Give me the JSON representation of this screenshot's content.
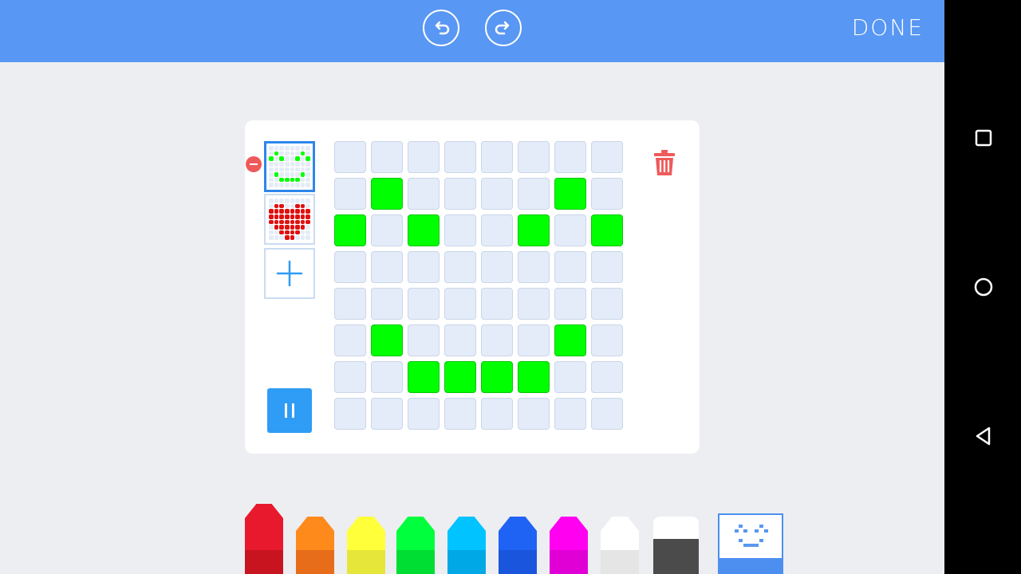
{
  "toolbar": {
    "undo_icon": "undo-icon",
    "redo_icon": "redo-icon",
    "done_label": "DONE",
    "color": "#5897f3"
  },
  "frames": [
    {
      "selected": true,
      "color": "#00ff00",
      "pixels": [
        [
          0,
          0,
          0,
          0,
          0,
          0,
          0,
          0
        ],
        [
          0,
          1,
          0,
          0,
          0,
          0,
          1,
          0
        ],
        [
          1,
          0,
          1,
          0,
          0,
          1,
          0,
          1
        ],
        [
          0,
          0,
          0,
          0,
          0,
          0,
          0,
          0
        ],
        [
          0,
          0,
          0,
          0,
          0,
          0,
          0,
          0
        ],
        [
          0,
          1,
          0,
          0,
          0,
          0,
          1,
          0
        ],
        [
          0,
          0,
          1,
          1,
          1,
          1,
          0,
          0
        ],
        [
          0,
          0,
          0,
          0,
          0,
          0,
          0,
          0
        ]
      ]
    },
    {
      "selected": false,
      "color": "#e01010",
      "pixels": [
        [
          0,
          0,
          0,
          0,
          0,
          0,
          0,
          0
        ],
        [
          0,
          1,
          1,
          0,
          0,
          1,
          1,
          0
        ],
        [
          1,
          1,
          1,
          1,
          1,
          1,
          1,
          1
        ],
        [
          1,
          1,
          1,
          1,
          1,
          1,
          1,
          1
        ],
        [
          1,
          1,
          1,
          1,
          1,
          1,
          1,
          1
        ],
        [
          0,
          1,
          1,
          1,
          1,
          1,
          1,
          0
        ],
        [
          0,
          0,
          1,
          1,
          1,
          1,
          0,
          0
        ],
        [
          0,
          0,
          0,
          1,
          1,
          0,
          0,
          0
        ]
      ]
    }
  ],
  "editor": {
    "on_color": "#00ff00",
    "off_color": "#e4ecf9",
    "matrix": [
      [
        0,
        0,
        0,
        0,
        0,
        0,
        0,
        0
      ],
      [
        0,
        1,
        0,
        0,
        0,
        0,
        1,
        0
      ],
      [
        1,
        0,
        1,
        0,
        0,
        1,
        0,
        1
      ],
      [
        0,
        0,
        0,
        0,
        0,
        0,
        0,
        0
      ],
      [
        0,
        0,
        0,
        0,
        0,
        0,
        0,
        0
      ],
      [
        0,
        1,
        0,
        0,
        0,
        0,
        1,
        0
      ],
      [
        0,
        0,
        1,
        1,
        1,
        1,
        0,
        0
      ],
      [
        0,
        0,
        0,
        0,
        0,
        0,
        0,
        0
      ]
    ]
  },
  "palette": [
    {
      "name": "red",
      "color": "#e8192c",
      "dark": "#c8141f"
    },
    {
      "name": "orange",
      "color": "#ff8a1c",
      "dark": "#e86d1b"
    },
    {
      "name": "yellow",
      "color": "#ffff3a",
      "dark": "#e6e63a"
    },
    {
      "name": "green",
      "color": "#00ff3c",
      "dark": "#00dd33"
    },
    {
      "name": "light-blue",
      "color": "#00c3ff",
      "dark": "#00a8e6"
    },
    {
      "name": "blue",
      "color": "#1f63f5",
      "dark": "#1a55de"
    },
    {
      "name": "magenta",
      "color": "#ff00f0",
      "dark": "#e000d6"
    },
    {
      "name": "white",
      "color": "#ffffff",
      "dark": "#e5e5e5"
    }
  ],
  "icons": {
    "trash": "trash-icon",
    "add": "plus-icon",
    "pause": "pause-icon",
    "eraser": "eraser-icon",
    "face": "smiley-face-icon"
  }
}
